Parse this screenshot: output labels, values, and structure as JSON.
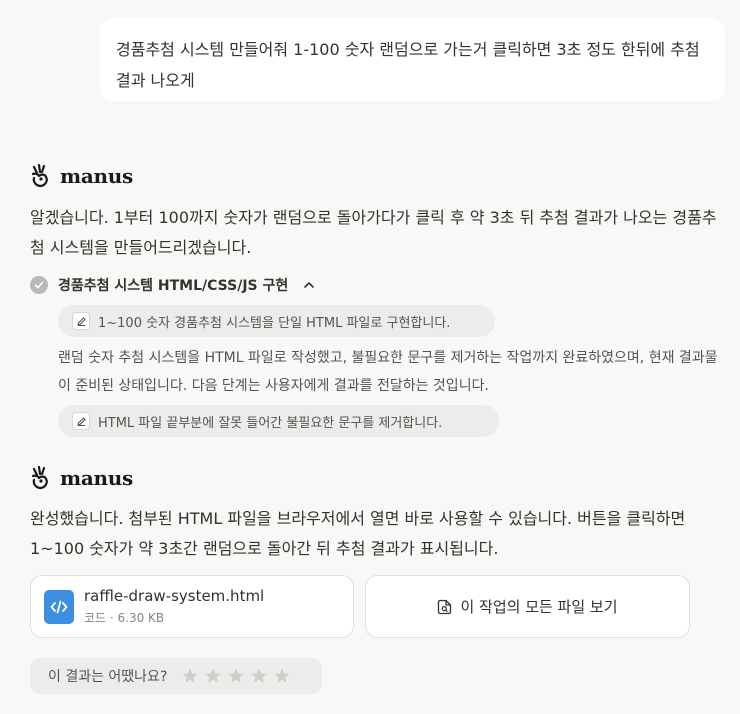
{
  "user_message": "경품추첨 시스템 만들어줘 1-100 숫자 랜덤으로 가는거 클릭하면 3초 정도 한뒤에 추첨결과 나오게",
  "brand": {
    "name": "manus",
    "icon": "manus-hand-logo-icon"
  },
  "assistant": {
    "intro": "알겠습니다. 1부터 100까지 숫자가 랜덤으로 돌아가다가 클릭 후 약 3초 뒤 추첨 결과가 나오는 경품추첨 시스템을 만들어드리겠습니다.",
    "task": {
      "title": "경품추첨 시스템 HTML/CSS/JS 구현",
      "status_icon": "check-circle-icon",
      "step1": "1~100 숫자 경품추첨 시스템을 단일 HTML 파일로 구현합니다.",
      "note": "랜덤 숫자 추첨 시스템을 HTML 파일로 작성했고, 불필요한 문구를 제거하는 작업까지 완료하였으며, 현재 결과물이 준비된 상태입니다. 다음 단계는 사용자에게 결과를 전달하는 것입니다.",
      "step2": "HTML 파일 끝부분에 잘못 들어간 불필요한 문구를 제거합니다."
    },
    "final": "완성했습니다. 첨부된 HTML 파일을 브라우저에서 열면 바로 사용할 수 있습니다. 버튼을 클릭하면 1~100 숫자가 약 3초간 랜덤으로 돌아간 뒤 추첨 결과가 표시됩니다."
  },
  "attachment": {
    "name": "raffle-draw-system.html",
    "meta": "코드 · 6.30 KB",
    "icon": "code-file-icon"
  },
  "view_all_files": "이 작업의 모든 파일 보기",
  "rating": {
    "label": "이 결과는 어땠나요?",
    "stars": 5,
    "selected": 0
  },
  "colors": {
    "background": "#f8f8f7",
    "file_icon": "#3c8fe0",
    "text": "#34322d"
  }
}
